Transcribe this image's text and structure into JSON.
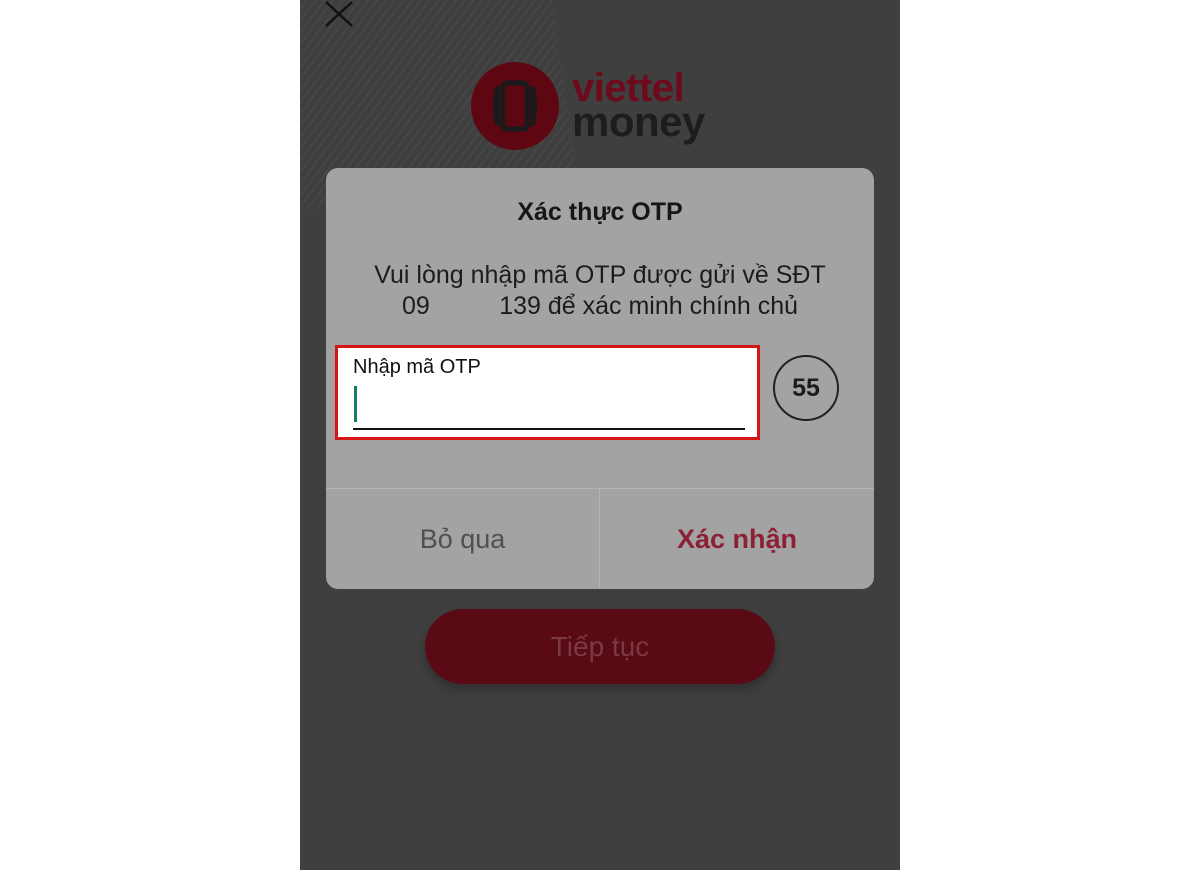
{
  "header": {
    "close_icon": "close-icon"
  },
  "logo": {
    "line1": "viettel",
    "line2": "money",
    "brand_color": "#6d0a1c"
  },
  "dialog": {
    "title": "Xác thực OTP",
    "message_line1": "Vui lòng nhập mã OTP được gửi về SĐT",
    "message_line2": "09          139 để xác minh chính chủ",
    "otp_field": {
      "label": "Nhập mã OTP",
      "value": ""
    },
    "timer": "55",
    "skip_label": "Bỏ qua",
    "confirm_label": "Xác nhận"
  },
  "continue_label": "Tiếp tục",
  "colors": {
    "overlay_bg": "#3f3f3f",
    "dialog_bg": "#a3a3a3",
    "highlight_border": "#d31515",
    "confirm_text": "#8c2035"
  }
}
